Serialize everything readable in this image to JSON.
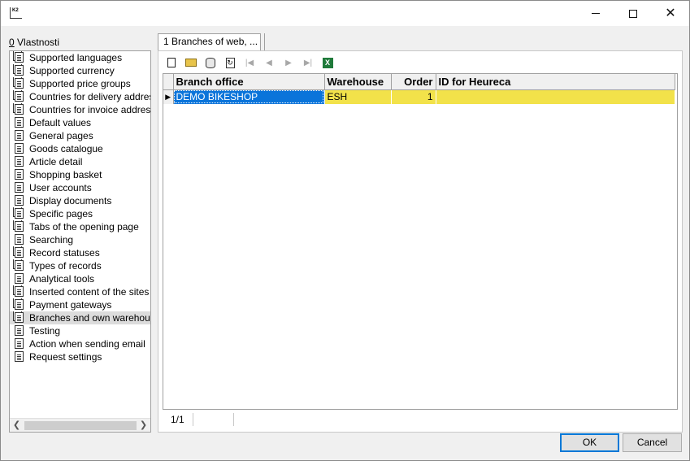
{
  "window": {
    "app_icon_text": "K2",
    "minimize": "minimize",
    "maximize": "maximize",
    "close": "close"
  },
  "left_panel": {
    "label_prefix": "0",
    "label": " Vlastnosti",
    "items": [
      {
        "label": "Supported languages",
        "icon": "document-stack-icon"
      },
      {
        "label": "Supported currency",
        "icon": "document-stack-icon"
      },
      {
        "label": "Supported price groups",
        "icon": "document-stack-icon"
      },
      {
        "label": "Countries for delivery addresses",
        "icon": "document-stack-icon"
      },
      {
        "label": "Countries for invoice addresses",
        "icon": "document-stack-icon"
      },
      {
        "label": "Default values",
        "icon": "document-icon"
      },
      {
        "label": "General pages",
        "icon": "document-icon"
      },
      {
        "label": "Goods catalogue",
        "icon": "document-icon"
      },
      {
        "label": "Article detail",
        "icon": "document-icon"
      },
      {
        "label": "Shopping basket",
        "icon": "document-icon"
      },
      {
        "label": "User accounts",
        "icon": "document-icon"
      },
      {
        "label": "Display documents",
        "icon": "document-icon"
      },
      {
        "label": "Specific pages",
        "icon": "document-stack-icon"
      },
      {
        "label": "Tabs of the opening page",
        "icon": "document-stack-icon"
      },
      {
        "label": "Searching",
        "icon": "document-icon"
      },
      {
        "label": "Record statuses",
        "icon": "document-stack-icon"
      },
      {
        "label": "Types of records",
        "icon": "document-stack-icon"
      },
      {
        "label": "Analytical tools",
        "icon": "document-icon"
      },
      {
        "label": "Inserted content of the sites",
        "icon": "document-stack-icon"
      },
      {
        "label": "Payment gateways",
        "icon": "document-stack-icon"
      },
      {
        "label": "Branches and own warehouses",
        "icon": "document-stack-icon"
      },
      {
        "label": "Testing",
        "icon": "document-icon"
      },
      {
        "label": "Action when sending email",
        "icon": "document-icon"
      },
      {
        "label": "Request settings",
        "icon": "document-icon"
      }
    ],
    "selected_index": 20
  },
  "tab": {
    "label": "1 Branches of web, ..."
  },
  "grid": {
    "columns": [
      "Branch office",
      "Warehouse",
      "Order",
      "ID for Heureca"
    ],
    "rows": [
      {
        "indicator": "▶",
        "branch_office": "DEMO BIKESHOP",
        "warehouse": "ESH",
        "order": "1",
        "id_for_heureca": ""
      }
    ]
  },
  "status": {
    "record_position": "1/1"
  },
  "buttons": {
    "ok": "OK",
    "cancel": "Cancel"
  },
  "colors": {
    "row_highlight": "#f2e24a",
    "selected_cell": "#0a74da"
  }
}
